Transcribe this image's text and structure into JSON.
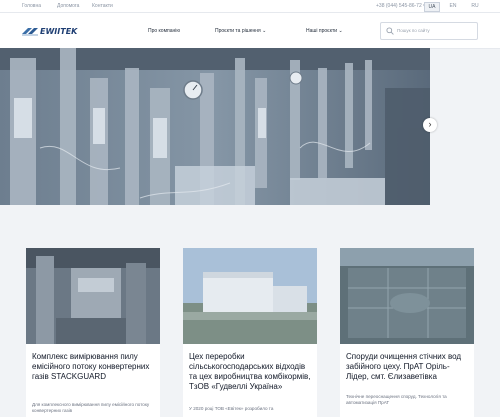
{
  "topbar": {
    "links": [
      "Головна",
      "Допомога",
      "Контакти"
    ],
    "phone": "+38 (044) 545-86-72 ▾",
    "languages": [
      "UA",
      "EN",
      "RU"
    ],
    "active_language": "UA"
  },
  "header": {
    "logo_text": "EWIITEK",
    "nav": {
      "about": "Про компанію",
      "projects": "Проєкти та рішення",
      "works": "Наші проєкти"
    },
    "search": {
      "placeholder": "Пошук по сайту"
    }
  },
  "hero": {
    "next_label": "›"
  },
  "cards": [
    {
      "title": "Комплекс вимірювання пилу емісійного потоку конвертерних газів STACKGUARD",
      "text": "Для комплексного вимірювання пилу емісійного потоку конвертерних газів"
    },
    {
      "title": "Цех переробки сільськогосподарських відходів та цех виробництва комбікормів, ТзОВ «Гудвеллі Україна»",
      "text": "У 2020 році ТОВ «Евітек» розробило та"
    },
    {
      "title": "Споруди очищення стічних вод забійного цеху. ПрАТ Оріль-Лідер, смт. Єлизаветівка",
      "text": "Технічне переоснащення споруд. Технологія та автоматизація ПрАТ"
    }
  ]
}
